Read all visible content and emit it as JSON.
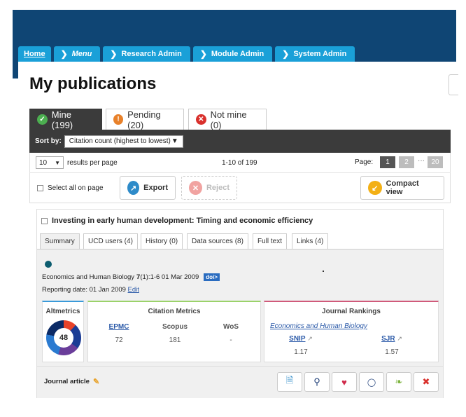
{
  "nav": {
    "items": [
      {
        "label": "Home"
      },
      {
        "label": "Menu"
      },
      {
        "label": "Research Admin"
      },
      {
        "label": "Module Admin"
      },
      {
        "label": "System Admin"
      }
    ]
  },
  "page": {
    "title": "My publications"
  },
  "tabs": [
    {
      "label": "Mine (199)",
      "icon": "check-circle-icon",
      "color": "#4caf50"
    },
    {
      "label": "Pending (20)",
      "icon": "exclamation-circle-icon",
      "color": "#e8812a"
    },
    {
      "label": "Not mine (0)",
      "icon": "x-circle-icon",
      "color": "#d9302c"
    }
  ],
  "sort": {
    "label": "Sort by:",
    "value": "Citation count (highest to lowest)"
  },
  "pager": {
    "per_page": "10",
    "per_page_label": "results per page",
    "range": "1-10 of 199",
    "page_label": "Page:",
    "pages": [
      "1",
      "2",
      "20"
    ],
    "ellipsis": "···"
  },
  "actions": {
    "select_all": "Select all on page",
    "export": "Export",
    "reject": "Reject",
    "compact": "Compact view"
  },
  "publication": {
    "title": "Investing in early human development: Timing and economic efficiency",
    "tabs": [
      "Summary",
      "UCD users (4)",
      "History (0)",
      "Data sources (8)",
      "Full text",
      "Links (4)"
    ],
    "journal": "Economics and Human Biology",
    "volume": "7",
    "issue_pages": "(1):1-6 01 Mar 2009",
    "doi_label": "doi>",
    "reporting_date": "Reporting date: 01 Jan 2009",
    "edit_label": "Edit",
    "altmetrics": {
      "title": "Altmetrics",
      "score": "48"
    },
    "citation_metrics": {
      "title": "Citation Metrics",
      "columns": [
        {
          "name": "EPMC",
          "value": "72"
        },
        {
          "name": "Scopus",
          "value": "181"
        },
        {
          "name": "WoS",
          "value": "-"
        }
      ]
    },
    "journal_rankings": {
      "title": "Journal Rankings",
      "journal": "Economics and Human Biology",
      "columns": [
        {
          "name": "SNIP",
          "value": "1.17"
        },
        {
          "name": "SJR",
          "value": "1.57"
        }
      ]
    },
    "type": "Journal article"
  },
  "colors": {
    "header": "#0f4574",
    "nav": "#1aa0d8",
    "dark_bar": "#3b3b3b"
  }
}
